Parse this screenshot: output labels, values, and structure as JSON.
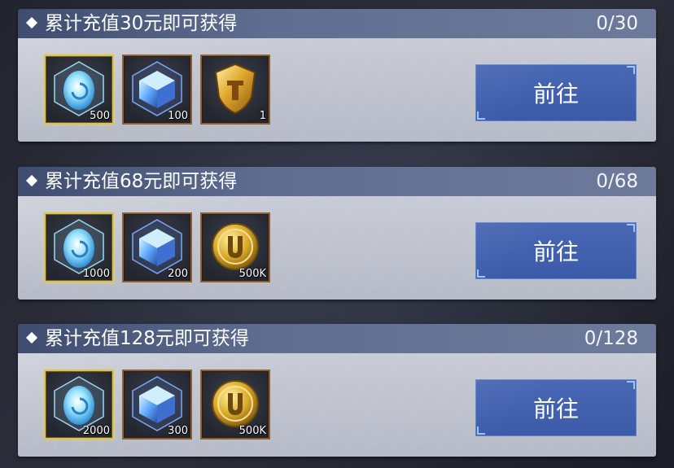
{
  "colors": {
    "header_bg": "#5f6e91",
    "card_bg": "#c9ccd6",
    "button_bg": "#4968b4",
    "gold_frame": "#d9c15a",
    "bronze_frame": "#8a6039"
  },
  "tasks": [
    {
      "title": "累计充值30元即可获得",
      "progress": "0/30",
      "button_label": "前往",
      "rewards": [
        {
          "icon": "crystal-egg-icon",
          "qty": "500",
          "frame": "gold"
        },
        {
          "icon": "blue-crystal-cube-icon",
          "qty": "100",
          "frame": "bronze"
        },
        {
          "icon": "gold-shield-icon",
          "qty": "1",
          "frame": "bronze"
        }
      ]
    },
    {
      "title": "累计充值68元即可获得",
      "progress": "0/68",
      "button_label": "前往",
      "rewards": [
        {
          "icon": "crystal-egg-icon",
          "qty": "1000",
          "frame": "gold"
        },
        {
          "icon": "blue-crystal-cube-icon",
          "qty": "200",
          "frame": "bronze"
        },
        {
          "icon": "gold-u-coin-icon",
          "qty": "500K",
          "frame": "bronze"
        }
      ]
    },
    {
      "title": "累计充值128元即可获得",
      "progress": "0/128",
      "button_label": "前往",
      "rewards": [
        {
          "icon": "crystal-egg-icon",
          "qty": "2000",
          "frame": "gold"
        },
        {
          "icon": "blue-crystal-cube-icon",
          "qty": "300",
          "frame": "bronze"
        },
        {
          "icon": "gold-u-coin-icon",
          "qty": "500K",
          "frame": "bronze"
        }
      ]
    }
  ]
}
